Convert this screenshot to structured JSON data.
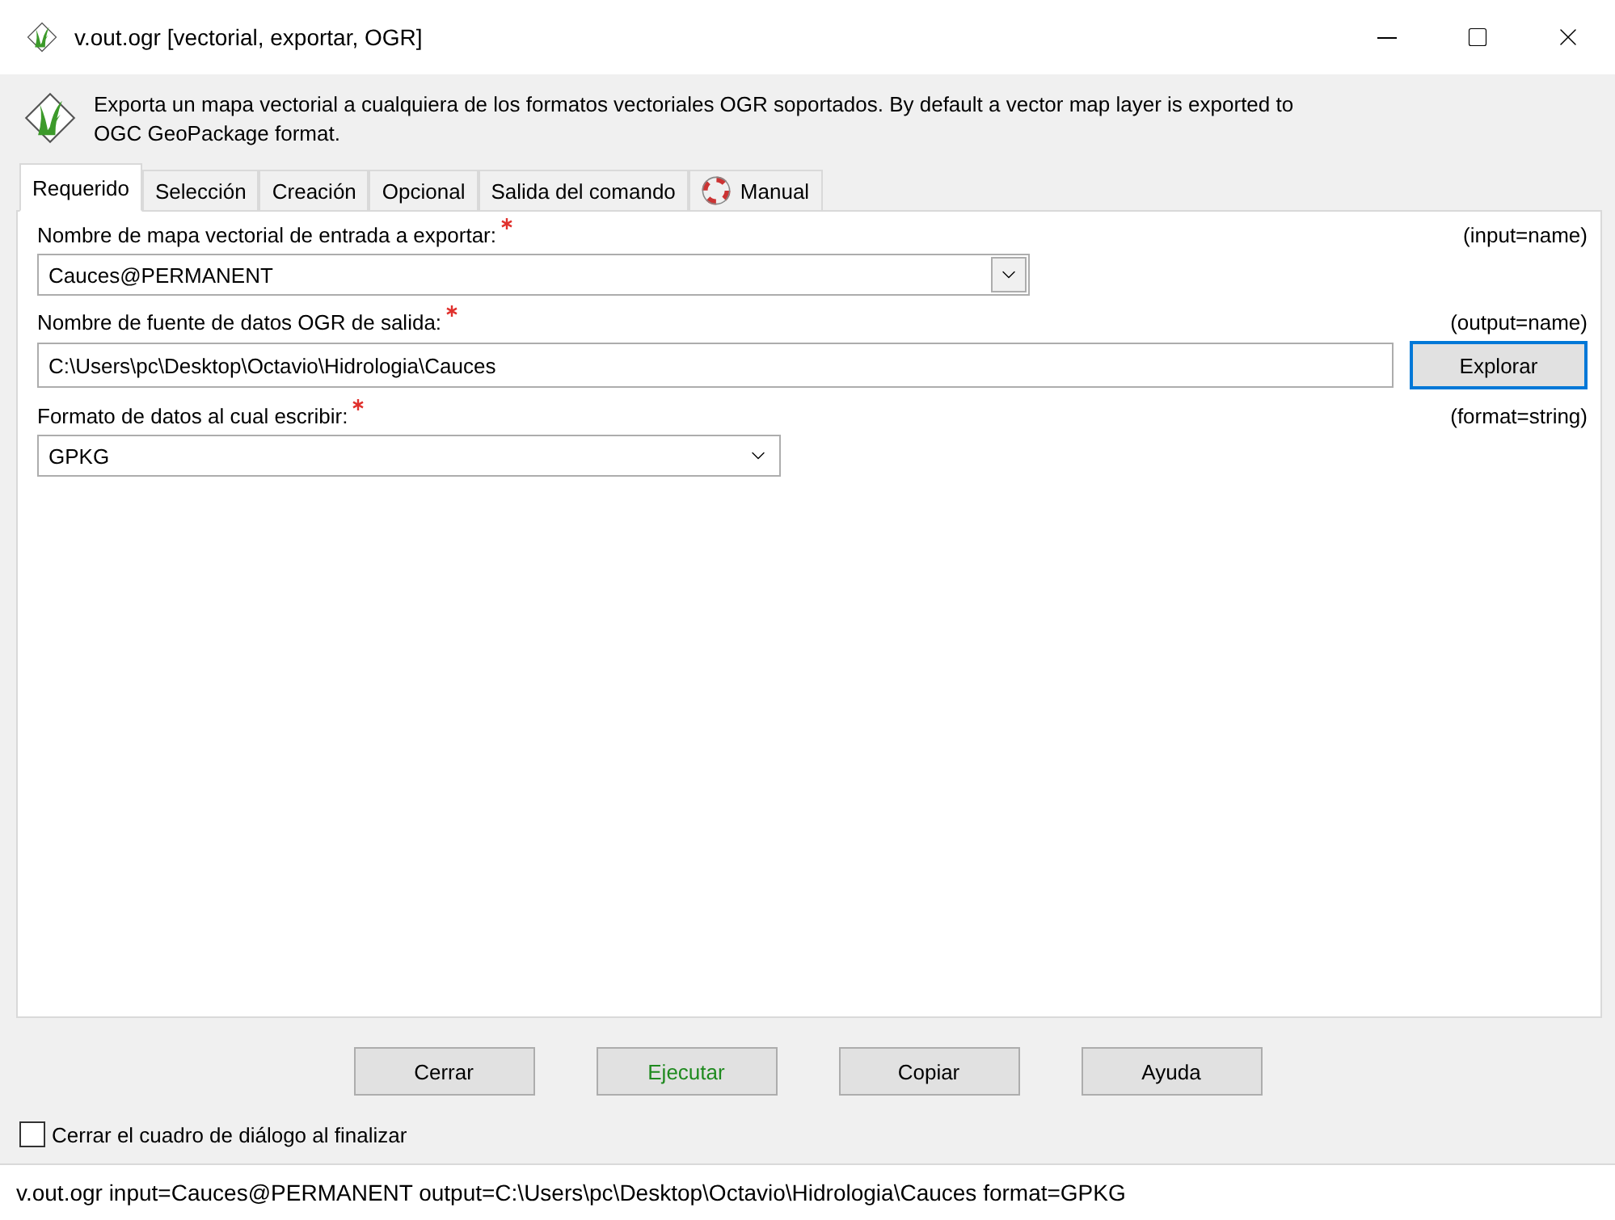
{
  "window": {
    "title": "v.out.ogr [vectorial, exportar, OGR]"
  },
  "description": "Exporta un mapa vectorial a cualquiera de los formatos vectoriales OGR soportados. By default a vector map layer is exported to OGC GeoPackage format.",
  "tabs": [
    {
      "label": "Requerido",
      "selected": true,
      "icon": false
    },
    {
      "label": "Selección",
      "selected": false,
      "icon": false
    },
    {
      "label": "Creación",
      "selected": false,
      "icon": false
    },
    {
      "label": "Opcional",
      "selected": false,
      "icon": false
    },
    {
      "label": "Salida del comando",
      "selected": false,
      "icon": false
    },
    {
      "label": "Manual",
      "selected": false,
      "icon": true
    }
  ],
  "fields": [
    {
      "kind": "combo",
      "label": "Nombre de mapa vectorial de entrada a exportar:",
      "required": true,
      "param": "(input=name)",
      "value": "Cauces@PERMANENT"
    },
    {
      "kind": "file",
      "label": "Nombre de fuente de datos OGR de salida:",
      "required": true,
      "param": "(output=name)",
      "value": "C:\\Users\\pc\\Desktop\\Octavio\\Hidrologia\\Cauces",
      "button": "Explorar"
    },
    {
      "kind": "select",
      "label": "Formato de datos al cual escribir:",
      "required": true,
      "param": "(format=string)",
      "value": "GPKG"
    }
  ],
  "buttons": [
    {
      "label": "Cerrar",
      "kind": "normal"
    },
    {
      "label": "Ejecutar",
      "kind": "run"
    },
    {
      "label": "Copiar",
      "kind": "normal"
    },
    {
      "label": "Ayuda",
      "kind": "normal"
    }
  ],
  "close_on_finish": {
    "label": "Cerrar el cuadro de diálogo al finalizar",
    "checked": false
  },
  "status_bar": "v.out.ogr input=Cauces@PERMANENT output=C:\\Users\\pc\\Desktop\\Octavio\\Hidrologia\\Cauces format=GPKG"
}
